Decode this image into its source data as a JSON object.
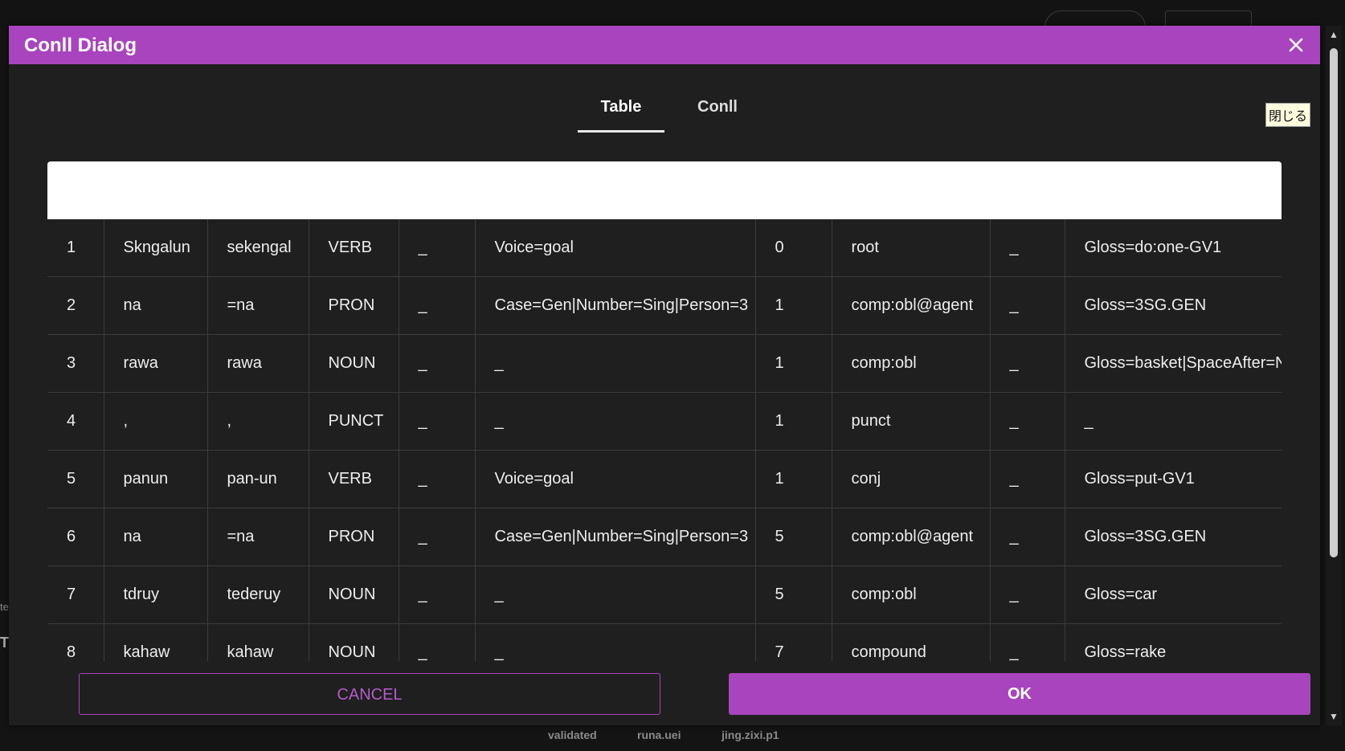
{
  "dialog": {
    "title": "Conll Dialog",
    "close_icon": "close-icon"
  },
  "tabs": [
    {
      "label": "Table",
      "active": true
    },
    {
      "label": "Conll",
      "active": false
    }
  ],
  "tooltip": "閉じる",
  "table": {
    "rows": [
      [
        "1",
        "Skngalun",
        "sekengal",
        "VERB",
        "_",
        "Voice=goal",
        "0",
        "root",
        "_",
        "Gloss=do:one-GV1"
      ],
      [
        "2",
        "na",
        "=na",
        "PRON",
        "_",
        "Case=Gen|Number=Sing|Person=3",
        "1",
        "comp:obl@agent",
        "_",
        "Gloss=3SG.GEN"
      ],
      [
        "3",
        "rawa",
        "rawa",
        "NOUN",
        "_",
        "_",
        "1",
        "comp:obl",
        "_",
        "Gloss=basket|SpaceAfter=N"
      ],
      [
        "4",
        ",",
        ",",
        "PUNCT",
        "_",
        "_",
        "1",
        "punct",
        "_",
        "_"
      ],
      [
        "5",
        "panun",
        "pan-un",
        "VERB",
        "_",
        "Voice=goal",
        "1",
        "conj",
        "_",
        "Gloss=put-GV1"
      ],
      [
        "6",
        "na",
        "=na",
        "PRON",
        "_",
        "Case=Gen|Number=Sing|Person=3",
        "5",
        "comp:obl@agent",
        "_",
        "Gloss=3SG.GEN"
      ],
      [
        "7",
        "tdruy",
        "tederuy",
        "NOUN",
        "_",
        "_",
        "5",
        "comp:obl",
        "_",
        "Gloss=car"
      ],
      [
        "8",
        "kahaw",
        "kahaw",
        "NOUN",
        "_",
        "_",
        "7",
        "compound",
        "_",
        "Gloss=rake"
      ]
    ]
  },
  "buttons": {
    "cancel": "CANCEL",
    "ok": "OK"
  },
  "status_bar": {
    "items": [
      "validated",
      "runa.uei",
      "jing.zixi.p1"
    ]
  },
  "background": {
    "left_snippets": [
      "te",
      "T"
    ]
  },
  "colors": {
    "accent": "#a844bd",
    "dialog_bg": "#1f1f1f"
  }
}
